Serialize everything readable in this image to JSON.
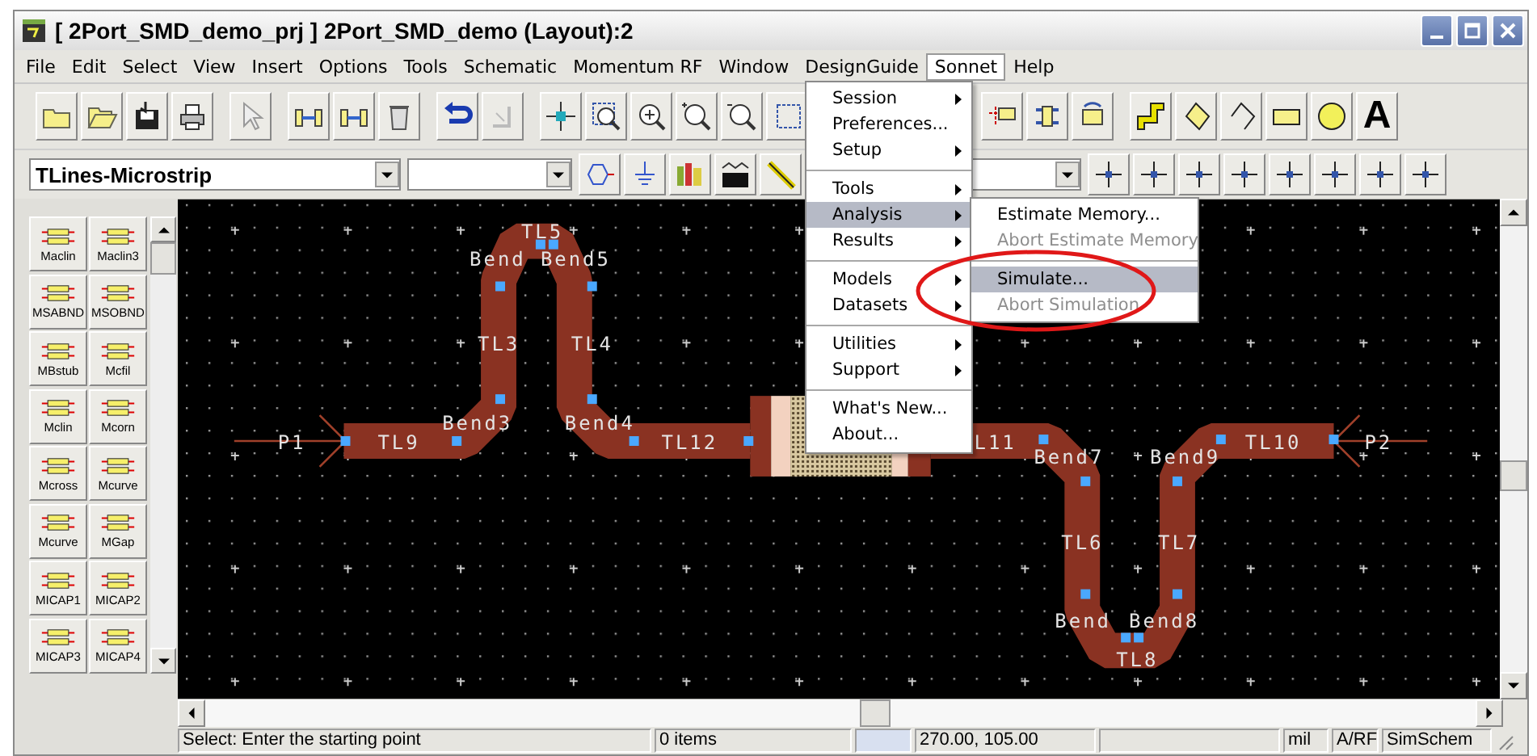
{
  "window": {
    "title": "[ 2Port_SMD_demo_prj ] 2Port_SMD_demo (Layout):2"
  },
  "menu_bar": [
    {
      "label": "File",
      "selected": false
    },
    {
      "label": "Edit",
      "selected": false
    },
    {
      "label": "Select",
      "selected": false
    },
    {
      "label": "View",
      "selected": false
    },
    {
      "label": "Insert",
      "selected": false
    },
    {
      "label": "Options",
      "selected": false
    },
    {
      "label": "Tools",
      "selected": false
    },
    {
      "label": "Schematic",
      "selected": false
    },
    {
      "label": "Momentum RF",
      "selected": false
    },
    {
      "label": "Window",
      "selected": false
    },
    {
      "label": "DesignGuide",
      "selected": false
    },
    {
      "label": "Sonnet",
      "selected": true
    },
    {
      "label": "Help",
      "selected": false
    }
  ],
  "toolbar": {
    "text_tool": "A"
  },
  "component_library": {
    "value": "TLines-Microstrip"
  },
  "palette": [
    {
      "label": "Maclin"
    },
    {
      "label": "Maclin3"
    },
    {
      "label": "MSABND"
    },
    {
      "label": "MSOBND"
    },
    {
      "label": "MBstub"
    },
    {
      "label": "Mcfil"
    },
    {
      "label": "Mclin"
    },
    {
      "label": "Mcorn"
    },
    {
      "label": "Mcross"
    },
    {
      "label": "Mcurve"
    },
    {
      "label": "Mcurve"
    },
    {
      "label": "MGap"
    },
    {
      "label": "MICAP1"
    },
    {
      "label": "MICAP2"
    },
    {
      "label": "MICAP3"
    },
    {
      "label": "MICAP4"
    }
  ],
  "layout": {
    "labels": [
      "P1",
      "TL9",
      "Bend3",
      "Bend4",
      "TL12",
      "TL3",
      "TL4",
      "TL5",
      "Bend",
      "Bend5",
      "L11",
      "Bend7",
      "Bend9",
      "TL10",
      "P2",
      "TL6",
      "TL7",
      "Bend",
      "Bend8",
      "TL8"
    ]
  },
  "sonnet_menu": {
    "groups": [
      [
        {
          "label": "Session",
          "has_submenu": true,
          "selected": false,
          "disabled": false
        },
        {
          "label": "Preferences...",
          "has_submenu": false,
          "selected": false,
          "disabled": false
        },
        {
          "label": "Setup",
          "has_submenu": true,
          "selected": false,
          "disabled": false
        }
      ],
      [
        {
          "label": "Tools",
          "has_submenu": true,
          "selected": false,
          "disabled": false
        },
        {
          "label": "Analysis",
          "has_submenu": true,
          "selected": true,
          "disabled": false
        },
        {
          "label": "Results",
          "has_submenu": true,
          "selected": false,
          "disabled": false
        }
      ],
      [
        {
          "label": "Models",
          "has_submenu": true,
          "selected": false,
          "disabled": false
        },
        {
          "label": "Datasets",
          "has_submenu": true,
          "selected": false,
          "disabled": false
        }
      ],
      [
        {
          "label": "Utilities",
          "has_submenu": true,
          "selected": false,
          "disabled": false
        },
        {
          "label": "Support",
          "has_submenu": true,
          "selected": false,
          "disabled": false
        }
      ],
      [
        {
          "label": "What's New...",
          "has_submenu": false,
          "selected": false,
          "disabled": false
        },
        {
          "label": "About...",
          "has_submenu": false,
          "selected": false,
          "disabled": false
        }
      ]
    ]
  },
  "analysis_submenu": {
    "groups": [
      [
        {
          "label": "Estimate Memory...",
          "has_submenu": false,
          "selected": false,
          "disabled": false
        },
        {
          "label": "Abort Estimate Memory",
          "has_submenu": false,
          "selected": false,
          "disabled": true
        }
      ],
      [
        {
          "label": "Simulate...",
          "has_submenu": false,
          "selected": true,
          "disabled": false
        },
        {
          "label": "Abort Simulation",
          "has_submenu": false,
          "selected": false,
          "disabled": true
        }
      ]
    ]
  },
  "status_bar": [
    "Select: Enter the starting point",
    "0 items",
    "270.00, 105.00",
    "mil",
    "A/RF",
    "SimSchem"
  ]
}
